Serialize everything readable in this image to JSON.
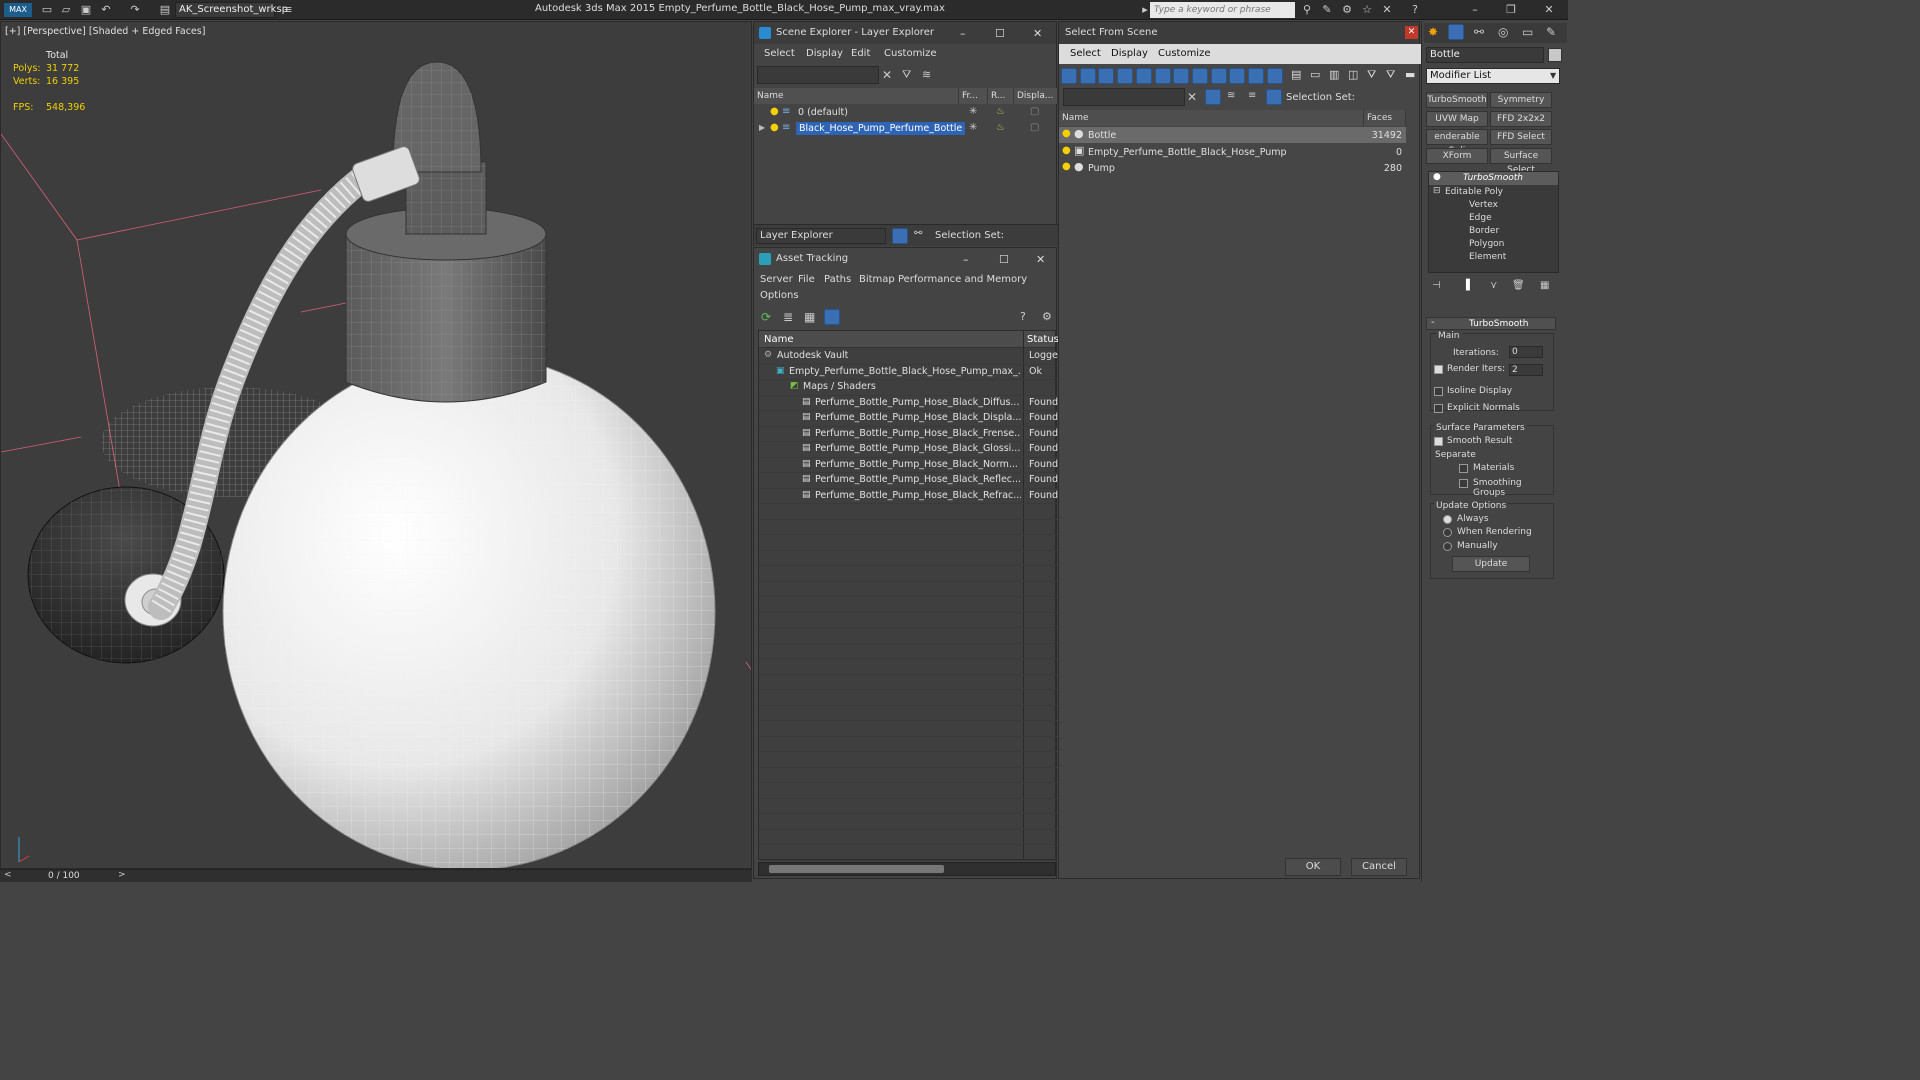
{
  "titlebar": {
    "workspace": "AK_Screenshot_wrksp",
    "app_title": "Autodesk 3ds Max 2015    Empty_Perfume_Bottle_Black_Hose_Pump_max_vray.max",
    "search_placeholder": "Type a keyword or phrase"
  },
  "viewport": {
    "label": "[+] [Perspective] [Shaded + Edged Faces]",
    "stats": {
      "total_label": "Total",
      "polys_label": "Polys:",
      "polys_value": "31 772",
      "verts_label": "Verts:",
      "verts_value": "16 395",
      "fps_label": "FPS:",
      "fps_value": "548,396"
    },
    "timeline": "0 / 100"
  },
  "scene_explorer": {
    "title": "Scene Explorer - Layer Explorer",
    "menu": [
      "Select",
      "Display",
      "Edit",
      "Customize"
    ],
    "columns": [
      "Name",
      "Fr...",
      "R...",
      "Displa..."
    ],
    "rows": [
      "0 (default)",
      "Black_Hose_Pump_Perfume_Bottle"
    ],
    "footer_dropdown": "Layer Explorer",
    "selection_set": "Selection Set:"
  },
  "asset_tracking": {
    "title": "Asset Tracking",
    "menu": [
      "Server",
      "File",
      "Paths",
      "Bitmap Performance and Memory",
      "Options"
    ],
    "columns": [
      "Name",
      "Status"
    ],
    "rows": [
      {
        "name": "Autodesk Vault",
        "status": "Logged"
      },
      {
        "name": "Empty_Perfume_Bottle_Black_Hose_Pump_max_...",
        "status": "Ok"
      },
      {
        "name": "Maps / Shaders",
        "status": ""
      },
      {
        "name": "Perfume_Bottle_Pump_Hose_Black_Diffus...",
        "status": "Found"
      },
      {
        "name": "Perfume_Bottle_Pump_Hose_Black_Displa...",
        "status": "Found"
      },
      {
        "name": "Perfume_Bottle_Pump_Hose_Black_Frense...",
        "status": "Found"
      },
      {
        "name": "Perfume_Bottle_Pump_Hose_Black_Glossi...",
        "status": "Found"
      },
      {
        "name": "Perfume_Bottle_Pump_Hose_Black_Norm...",
        "status": "Found"
      },
      {
        "name": "Perfume_Bottle_Pump_Hose_Black_Reflec...",
        "status": "Found"
      },
      {
        "name": "Perfume_Bottle_Pump_Hose_Black_Refrac...",
        "status": "Found"
      }
    ]
  },
  "select_from_scene": {
    "title": "Select From Scene",
    "menu": [
      "Select",
      "Display",
      "Customize"
    ],
    "selection_set": "Selection Set:",
    "columns": [
      "Name",
      "Faces"
    ],
    "rows": [
      {
        "name": "Bottle",
        "faces": "31492"
      },
      {
        "name": "Empty_Perfume_Bottle_Black_Hose_Pump",
        "faces": "0"
      },
      {
        "name": "Pump",
        "faces": "280"
      }
    ],
    "ok": "OK",
    "cancel": "Cancel"
  },
  "command_panel": {
    "object_name": "Bottle",
    "modifier_list": "Modifier List",
    "mod_buttons": [
      "TurboSmooth",
      "Symmetry",
      "UVW Map",
      "FFD 2x2x2",
      "enderable Spli",
      "FFD Select",
      "XForm",
      "Surface Select"
    ],
    "stack": [
      "TurboSmooth",
      "Editable Poly",
      "Vertex",
      "Edge",
      "Border",
      "Polygon",
      "Element"
    ],
    "rollout_title": "TurboSmooth",
    "main_label": "Main",
    "iterations_label": "Iterations:",
    "iterations_value": "0",
    "render_iters_label": "Render Iters:",
    "render_iters_value": "2",
    "isoline": "Isoline Display",
    "explicit_normals": "Explicit Normals",
    "surface_params": "Surface Parameters",
    "smooth_result": "Smooth Result",
    "separate": "Separate",
    "materials": "Materials",
    "smoothing_groups": "Smoothing Groups",
    "update_options": "Update Options",
    "always": "Always",
    "when_rendering": "When Rendering",
    "manually": "Manually",
    "update_btn": "Update"
  }
}
